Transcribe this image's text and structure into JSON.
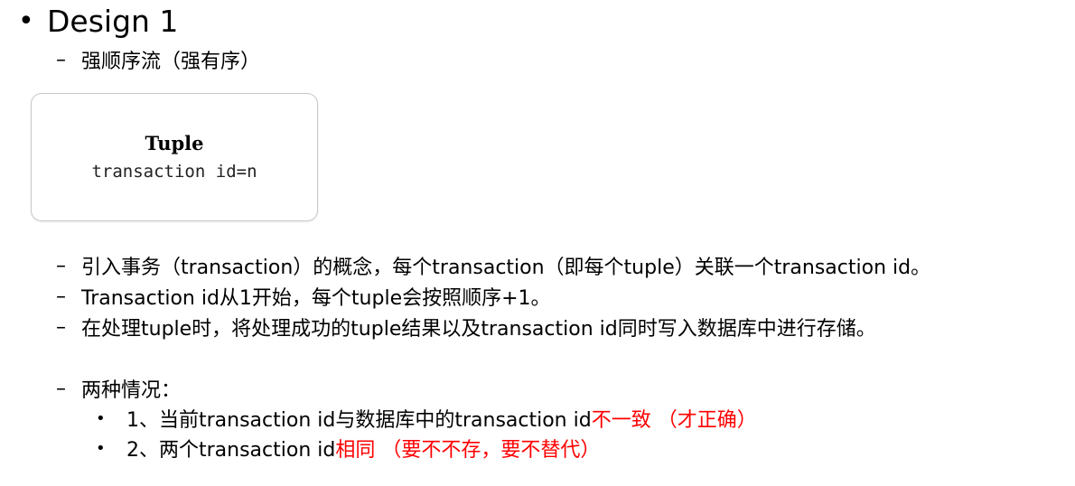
{
  "heading": {
    "bullet": "•",
    "title": "Design 1"
  },
  "subtitle": {
    "dash": "–",
    "text": "强顺序流（强有序）"
  },
  "tuple_box": {
    "title": "Tuple",
    "subtitle": "transaction id=n"
  },
  "points": [
    {
      "dash": "–",
      "text": "引入事务（transaction）的概念，每个transaction（即每个tuple）关联一个transaction id。"
    },
    {
      "dash": "–",
      "text": "Transaction id从1开始，每个tuple会按照顺序+1。"
    },
    {
      "dash": "–",
      "text": "在处理tuple时，将处理成功的tuple结果以及transaction id同时写入数据库中进行存储。"
    },
    {
      "dash": "–",
      "text": "两种情况："
    }
  ],
  "cases": [
    {
      "bullet": "•",
      "text": "1、当前transaction id与数据库中的transaction id",
      "highlight": "不一致 （才正确）",
      "highlight_color": "#ff0000"
    },
    {
      "bullet": "•",
      "text": "2、两个transaction id",
      "highlight": "相同 （要不不存，要不替代）",
      "highlight_color": "#ff0000"
    }
  ]
}
